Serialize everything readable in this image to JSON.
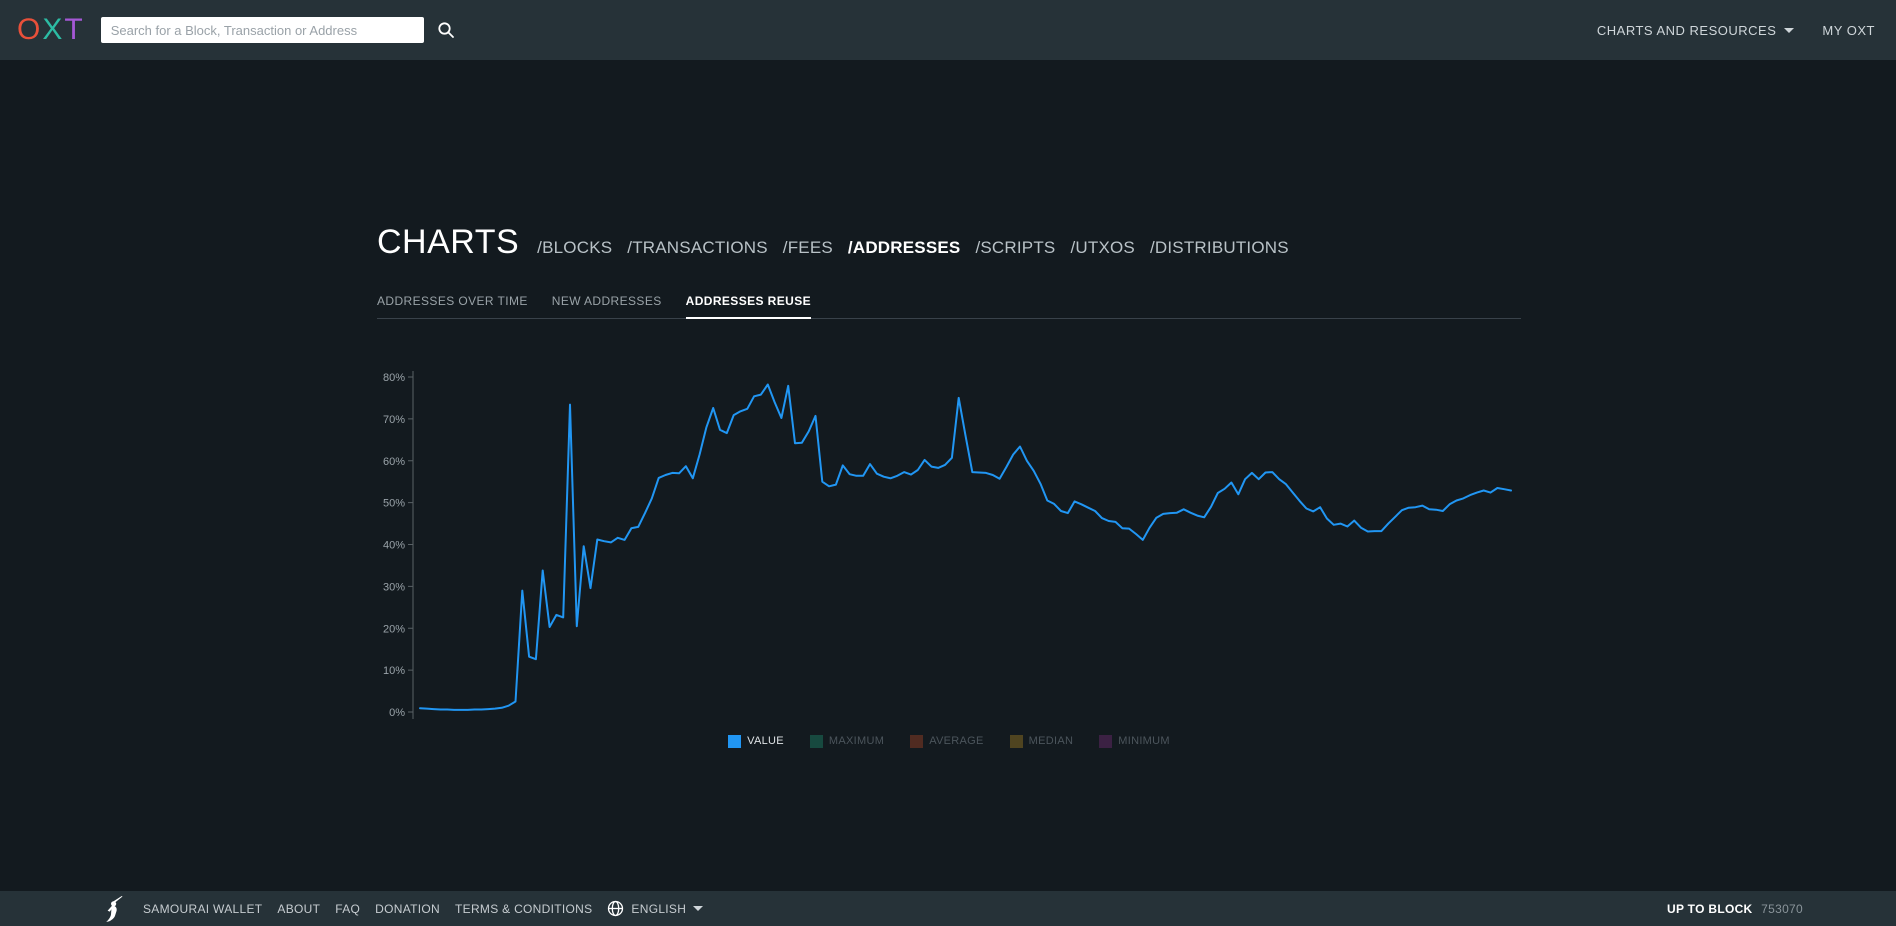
{
  "header": {
    "logo": {
      "letters": [
        {
          "char": "O",
          "color": "#e8503a"
        },
        {
          "char": "X",
          "color": "#2cbca4"
        },
        {
          "char": "T",
          "color": "#a558d6"
        }
      ]
    },
    "search": {
      "placeholder": "Search for a Block, Transaction or Address"
    },
    "menu": {
      "charts_and_resources": "CHARTS AND RESOURCES",
      "my_oxt": "MY OXT"
    }
  },
  "page": {
    "title": "CHARTS",
    "sections": [
      {
        "label": "/BLOCKS",
        "active": false
      },
      {
        "label": "/TRANSACTIONS",
        "active": false
      },
      {
        "label": "/FEES",
        "active": false
      },
      {
        "label": "/ADDRESSES",
        "active": true
      },
      {
        "label": "/SCRIPTS",
        "active": false
      },
      {
        "label": "/UTXOS",
        "active": false
      },
      {
        "label": "/DISTRIBUTIONS",
        "active": false
      }
    ],
    "tabs": [
      {
        "label": "ADDRESSES OVER TIME",
        "active": false
      },
      {
        "label": "NEW ADDRESSES",
        "active": false
      },
      {
        "label": "ADDRESSES REUSE",
        "active": true
      }
    ]
  },
  "chart_data": {
    "type": "line",
    "title": "",
    "xlabel": "",
    "ylabel": "",
    "ylim": [
      0,
      80
    ],
    "y_tick_step": 10,
    "y_tick_suffix": "%",
    "y_tick_labels": [
      "0%",
      "10%",
      "20%",
      "30%",
      "40%",
      "50%",
      "60%",
      "70%",
      "80%"
    ],
    "x_tick_labels_visible": false,
    "grid": false,
    "legend_position": "bottom-center",
    "series": [
      {
        "name": "VALUE",
        "color": "#2196f3",
        "values": [
          0.9,
          0.8,
          0.7,
          0.6,
          0.6,
          0.5,
          0.5,
          0.5,
          0.6,
          0.6,
          0.7,
          0.8,
          1.0,
          1.5,
          2.5,
          29.0,
          13.2,
          12.6,
          33.8,
          20.3,
          23.2,
          22.6,
          73.4,
          20.5,
          39.6,
          29.6,
          41.2,
          40.8,
          40.5,
          41.6,
          41.1,
          43.9,
          44.2,
          47.5,
          51.0,
          55.9,
          56.6,
          57.1,
          57.0,
          58.7,
          55.8,
          61.5,
          68.0,
          72.6,
          67.4,
          66.6,
          70.9,
          71.8,
          72.4,
          75.4,
          75.8,
          78.2,
          74.0,
          70.2,
          77.9,
          64.2,
          64.3,
          67.0,
          70.7,
          55.0,
          53.9,
          54.3,
          58.9,
          56.8,
          56.4,
          56.4,
          59.2,
          56.9,
          56.2,
          55.8,
          56.4,
          57.3,
          56.7,
          57.8,
          60.2,
          58.6,
          58.3,
          59.0,
          60.7,
          75.0,
          66.0,
          57.3,
          57.2,
          57.1,
          56.6,
          55.7,
          58.5,
          61.5,
          63.4,
          60.0,
          57.6,
          54.5,
          50.5,
          49.7,
          48.0,
          47.5,
          50.3,
          49.6,
          48.8,
          48.0,
          46.3,
          45.6,
          45.4,
          43.9,
          43.8,
          42.5,
          41.1,
          44.0,
          46.4,
          47.3,
          47.5,
          47.6,
          48.4,
          47.6,
          46.9,
          46.5,
          49.0,
          52.3,
          53.3,
          54.8,
          52.0,
          55.6,
          57.1,
          55.6,
          57.2,
          57.3,
          55.6,
          54.4,
          52.4,
          50.4,
          48.6,
          47.9,
          48.9,
          46.2,
          44.7,
          45.0,
          44.3,
          45.7,
          44.0,
          43.1,
          43.2,
          43.2,
          45.0,
          46.6,
          48.2,
          48.8,
          48.9,
          49.3,
          48.4,
          48.3,
          48.0,
          49.6,
          50.5,
          51.0,
          51.8,
          52.4,
          52.9,
          52.4,
          53.5,
          53.2,
          52.9
        ]
      }
    ],
    "legend": [
      {
        "label": "VALUE",
        "color": "#2196f3",
        "enabled": true
      },
      {
        "label": "MAXIMUM",
        "color": "#17493f",
        "enabled": false
      },
      {
        "label": "AVERAGE",
        "color": "#502b21",
        "enabled": false
      },
      {
        "label": "MEDIAN",
        "color": "#4f4420",
        "enabled": false
      },
      {
        "label": "MINIMUM",
        "color": "#3b2143",
        "enabled": false
      }
    ]
  },
  "footer": {
    "links": [
      "SAMOURAI WALLET",
      "ABOUT",
      "FAQ",
      "DONATION",
      "TERMS & CONDITIONS"
    ],
    "language": "ENGLISH",
    "up_to_block_label": "UP TO BLOCK",
    "block_number": "753070"
  }
}
